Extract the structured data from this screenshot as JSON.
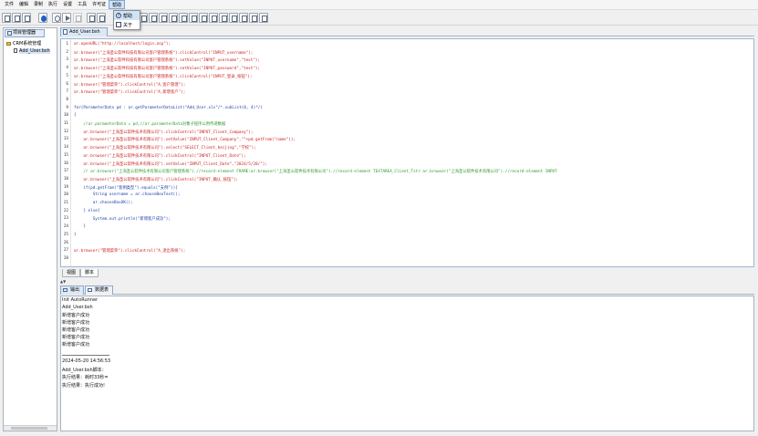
{
  "menubar": {
    "items": [
      "文件",
      "编辑",
      "录制",
      "执行",
      "设置",
      "工具",
      "许可证",
      "帮助"
    ],
    "open_index": 7
  },
  "help_menu": {
    "items": [
      "帮助",
      "关于"
    ]
  },
  "left_panel": {
    "tab_label": "项目管理器",
    "root": "CRM系统管理",
    "file": "Add_User.bsh"
  },
  "editor": {
    "tab_label": "Add_User.bsh",
    "lines": [
      {
        "n": "1",
        "color": "red",
        "text": "ar.openURL(\"http://localhost/login.asp\");"
      },
      {
        "n": "2",
        "color": "red",
        "text": "ar.browser(\"上海圣公软件科技有限公司客户管理系统\").clickControl(\"INPUT_username\");"
      },
      {
        "n": "3",
        "color": "red",
        "text": "ar.browser(\"上海圣公软件科技有限公司客户管理系统\").setValue(\"INPUT_username\",\"test\");"
      },
      {
        "n": "4",
        "color": "red",
        "text": "ar.browser(\"上海圣公软件科技有限公司客户管理系统\").setValue(\"INPUT_password\",\"test\");"
      },
      {
        "n": "5",
        "color": "red",
        "text": "ar.browser(\"上海圣公软件科技有限公司客户管理系统\").clickControl(\"INPUT_登录_按钮\");"
      },
      {
        "n": "6",
        "color": "red",
        "text": "ar.browser(\"管理菜单\").clickControl(\"A_客户管理\");"
      },
      {
        "n": "7",
        "color": "red",
        "text": "ar.browser(\"管理菜单\").clickControl(\"A_新增客户\");"
      },
      {
        "n": "8",
        "color": "black",
        "text": ""
      },
      {
        "n": "9",
        "color": "blue",
        "text": "for(ParameterData pd : ar.getParameterDataList(\"Add_User.xls\"/*.subList(0, 4)*/)"
      },
      {
        "n": "10",
        "color": "blue",
        "text": "{"
      },
      {
        "n": "11",
        "color": "green",
        "text": "    //ar.parameterData = pd;//ar.parameterData对象子程序公用传递数据"
      },
      {
        "n": "12",
        "color": "red",
        "text": "    ar.browser(\"上海圣公软件技术有限公司\").clickControl(\"INPUT_Client_Company\");"
      },
      {
        "n": "13",
        "color": "red",
        "text": "    ar.browser(\"上海圣公软件技术有限公司\").setValue(\"INPUT_Client_Company\",\"\"+pd.getFrom(\"name\"));"
      },
      {
        "n": "14",
        "color": "red",
        "text": "    ar.browser(\"上海圣公软件技术有限公司\").select(\"SELECT_Client_beijing\",\"学校\");"
      },
      {
        "n": "15",
        "color": "red",
        "text": "    ar.browser(\"上海圣公软件技术有限公司\").clickControl(\"INPUT_Client_Date\");"
      },
      {
        "n": "16",
        "color": "red",
        "text": "    ar.browser(\"上海圣公软件技术有限公司\").setValue(\"INPUT_Client_Date\",\"2024/5/20/\");"
      },
      {
        "n": "17",
        "color": "green",
        "text": "    // ar.browser(\"上海圣公软件技术有限公司客户管理系统\").//record-element FRAME:ar.browser(\"上海圣公软件技术有限公司\").//record-element TEXTAREA_Client_Tstr ar.browser(\"上海圣公软件技术有限公司\").//record-element INPUT"
      },
      {
        "n": "18",
        "color": "red",
        "text": "    ar.browser(\"上海圣公软件技术有限公司\").clickControl(\"INPUT_确认_按钮\");"
      },
      {
        "n": "19",
        "color": "blue",
        "text": "    if(pd.getFrom(\"客例类型\").equals(\"支例\")){"
      },
      {
        "n": "20",
        "color": "blue",
        "text": "        String username = ar.chooseBoxText();"
      },
      {
        "n": "21",
        "color": "blue",
        "text": "        ar.chooseBoxOK();"
      },
      {
        "n": "22",
        "color": "blue",
        "text": "    } else{"
      },
      {
        "n": "23",
        "color": "blue",
        "text": "        System.out.println(\"新增客户成功\");"
      },
      {
        "n": "24",
        "color": "blue",
        "text": "    }"
      },
      {
        "n": "25",
        "color": "blue",
        "text": "}"
      },
      {
        "n": "26",
        "color": "black",
        "text": ""
      },
      {
        "n": "27",
        "color": "red",
        "text": "ar.browser(\"管理菜单\").clickControl(\"A_退出系统\");"
      },
      {
        "n": "28",
        "color": "black",
        "text": ""
      }
    ]
  },
  "view_tabs": [
    "视图",
    "脚本"
  ],
  "splitter_mark": "▲▼",
  "output": {
    "tabs": [
      "输出",
      "数据表"
    ],
    "lines_before_sep": [
      "Init AutoRunner",
      "Add_User.bsh",
      "新增客户成功",
      "新增客户成功",
      "新增客户成功",
      "新增客户成功",
      "新增客户成功"
    ],
    "lines_after_sep": [
      "2024-05-20 14:56:53",
      "Add_User.bsh脚本：",
      "执行结果：耗时33秒=",
      "执行结果：执行成功!"
    ]
  }
}
